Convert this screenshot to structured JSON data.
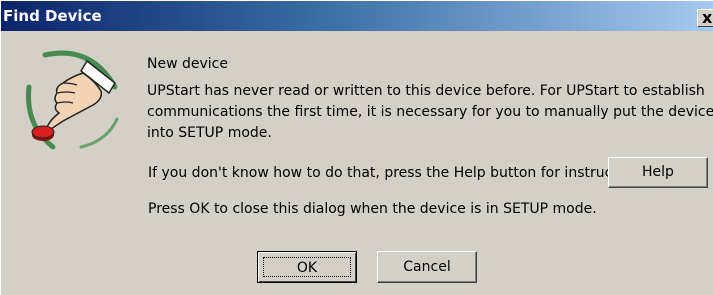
{
  "window": {
    "title": "Find Device",
    "close_glyph": "x"
  },
  "icon": {
    "name": "hand-pressing-button-icon",
    "button_color": "#d81e1e"
  },
  "message": {
    "heading": "New device",
    "paragraph_lines": [
      "UPStart has never read or written to this device before.  For UPStart to establish",
      "communications the first time, it is necessary for you to manually put the device",
      "into SETUP mode."
    ],
    "help_prompt": "If you don't know how to do that, press the Help button for instructions",
    "ok_prompt": "Press OK to close this dialog when the device is in SETUP mode."
  },
  "buttons": {
    "help": "Help",
    "ok": "OK",
    "cancel": "Cancel"
  },
  "colors": {
    "dialog_face": "#d4d0c8",
    "titlebar_start": "#0a246a",
    "titlebar_end": "#a6caf0"
  }
}
